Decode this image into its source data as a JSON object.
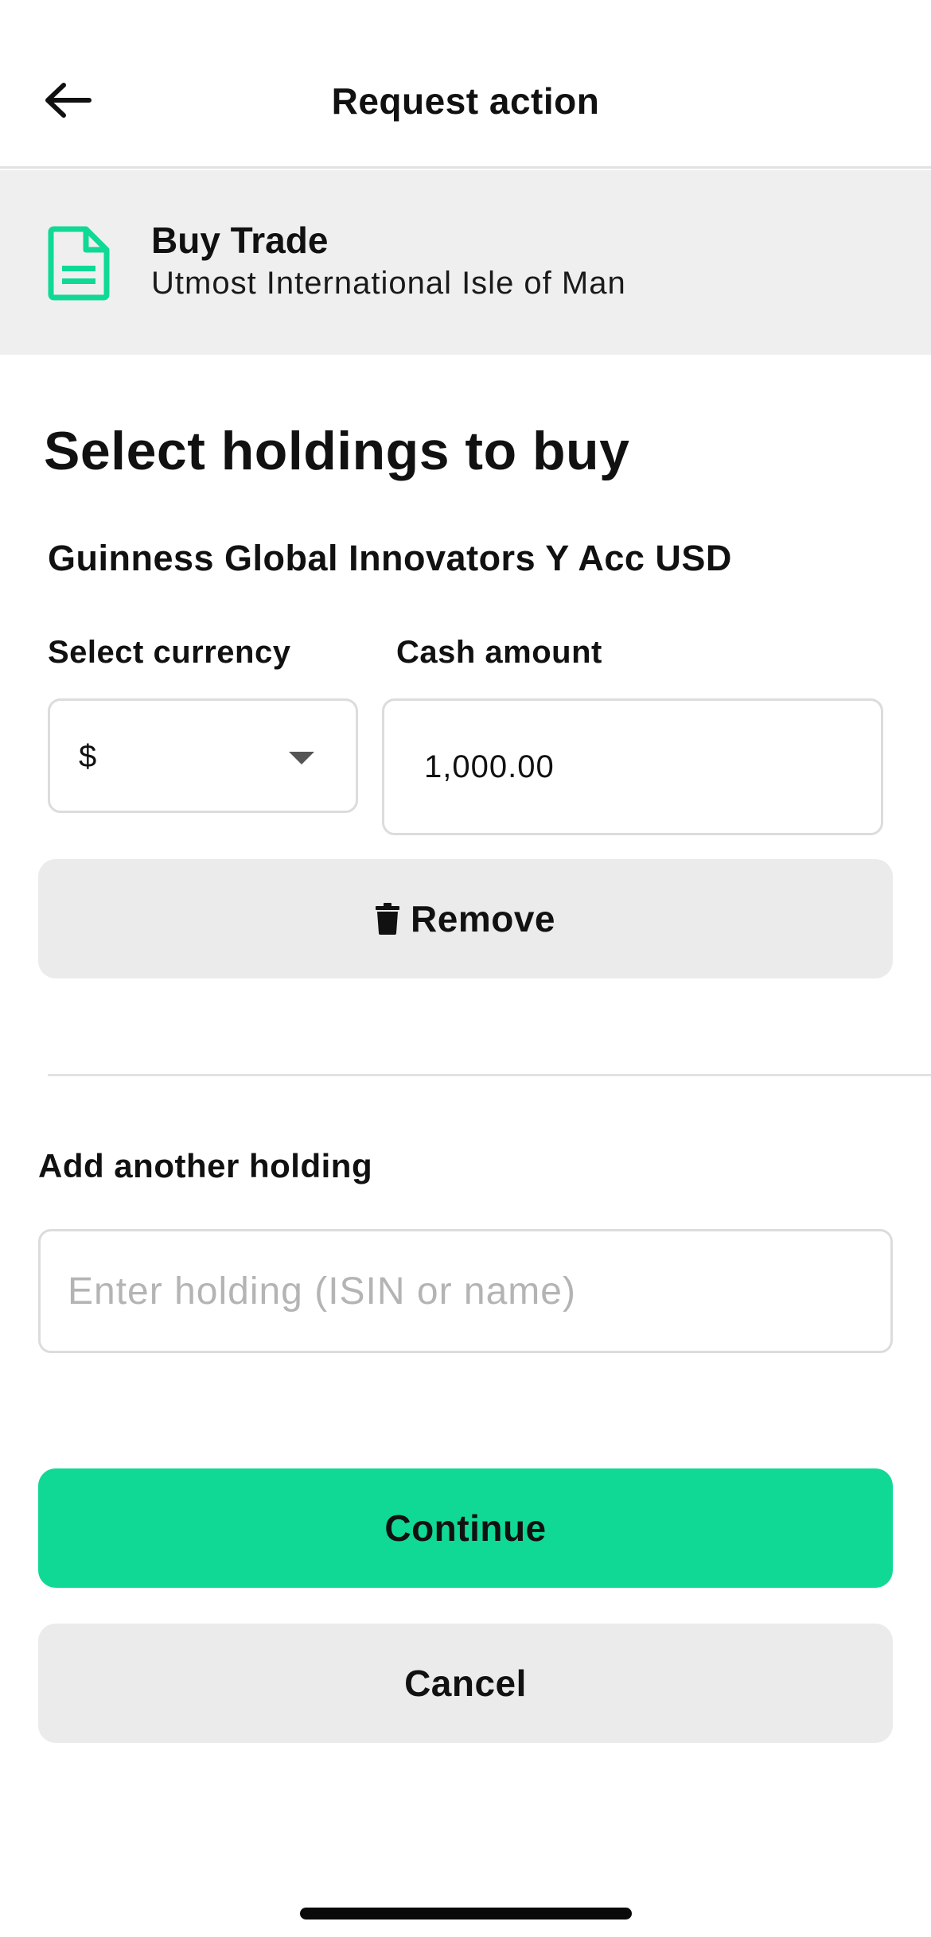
{
  "header": {
    "back_icon": "arrow-left-icon",
    "title": "Request action"
  },
  "banner": {
    "icon": "document-icon",
    "icon_color": "#10d995",
    "title": "Buy Trade",
    "subtitle": "Utmost International Isle of Man"
  },
  "main": {
    "section_title": "Select holdings to buy",
    "holding": {
      "name": "Guinness Global Innovators Y Acc USD",
      "currency_label": "Select currency",
      "currency_value": "$",
      "amount_label": "Cash amount",
      "amount_value": "1,000.00",
      "remove_label": "Remove",
      "remove_icon": "trash-icon"
    },
    "add_another": {
      "label": "Add another holding",
      "placeholder": "Enter holding (ISIN or name)"
    }
  },
  "actions": {
    "continue_label": "Continue",
    "continue_color": "#10d995",
    "cancel_label": "Cancel"
  }
}
